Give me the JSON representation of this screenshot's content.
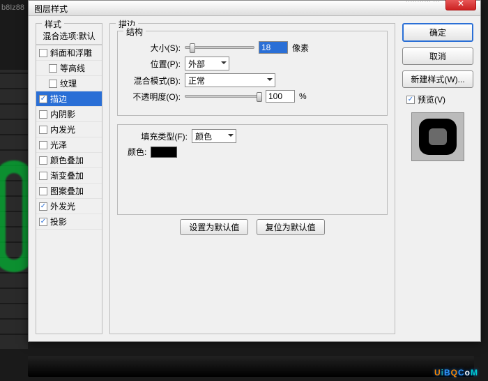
{
  "bg": {
    "label": "b8Iz88"
  },
  "header": {
    "right_text": "··········· ···",
    "close_glyph": "✕"
  },
  "dialog": {
    "title": "图层样式"
  },
  "styles": {
    "heading": "样式",
    "blend_header": "混合选项:默认",
    "items": [
      {
        "label": "斜面和浮雕",
        "checked": false,
        "indent": false
      },
      {
        "label": "等高线",
        "checked": false,
        "indent": true
      },
      {
        "label": "纹理",
        "checked": false,
        "indent": true
      },
      {
        "label": "描边",
        "checked": true,
        "indent": false,
        "selected": true
      },
      {
        "label": "内阴影",
        "checked": false,
        "indent": false
      },
      {
        "label": "内发光",
        "checked": false,
        "indent": false
      },
      {
        "label": "光泽",
        "checked": false,
        "indent": false
      },
      {
        "label": "颜色叠加",
        "checked": false,
        "indent": false
      },
      {
        "label": "渐变叠加",
        "checked": false,
        "indent": false
      },
      {
        "label": "图案叠加",
        "checked": false,
        "indent": false
      },
      {
        "label": "外发光",
        "checked": true,
        "indent": false
      },
      {
        "label": "投影",
        "checked": true,
        "indent": false
      }
    ]
  },
  "main": {
    "section_title": "描边",
    "structure": {
      "legend": "结构",
      "size_label": "大小(S):",
      "size_value": "18",
      "size_unit": "像素",
      "position_label": "位置(P):",
      "position_value": "外部",
      "blend_label": "混合模式(B):",
      "blend_value": "正常",
      "opacity_label": "不透明度(O):",
      "opacity_value": "100",
      "opacity_unit": "%"
    },
    "fill": {
      "fill_type_label": "填充类型(F):",
      "fill_type_value": "颜色",
      "color_label": "颜色:",
      "color_value": "#000000"
    },
    "buttons": {
      "make_default": "设置为默认值",
      "reset_default": "复位为默认值"
    }
  },
  "right": {
    "ok": "确定",
    "cancel": "取消",
    "new_style": "新建样式(W)...",
    "preview_label": "预览(V)",
    "preview_checked": true
  },
  "watermark": {
    "u": "U",
    "i": "i",
    "b": "B",
    "q": "Q",
    ".": ".",
    "c": "C",
    "o": "o",
    "m": "M"
  }
}
